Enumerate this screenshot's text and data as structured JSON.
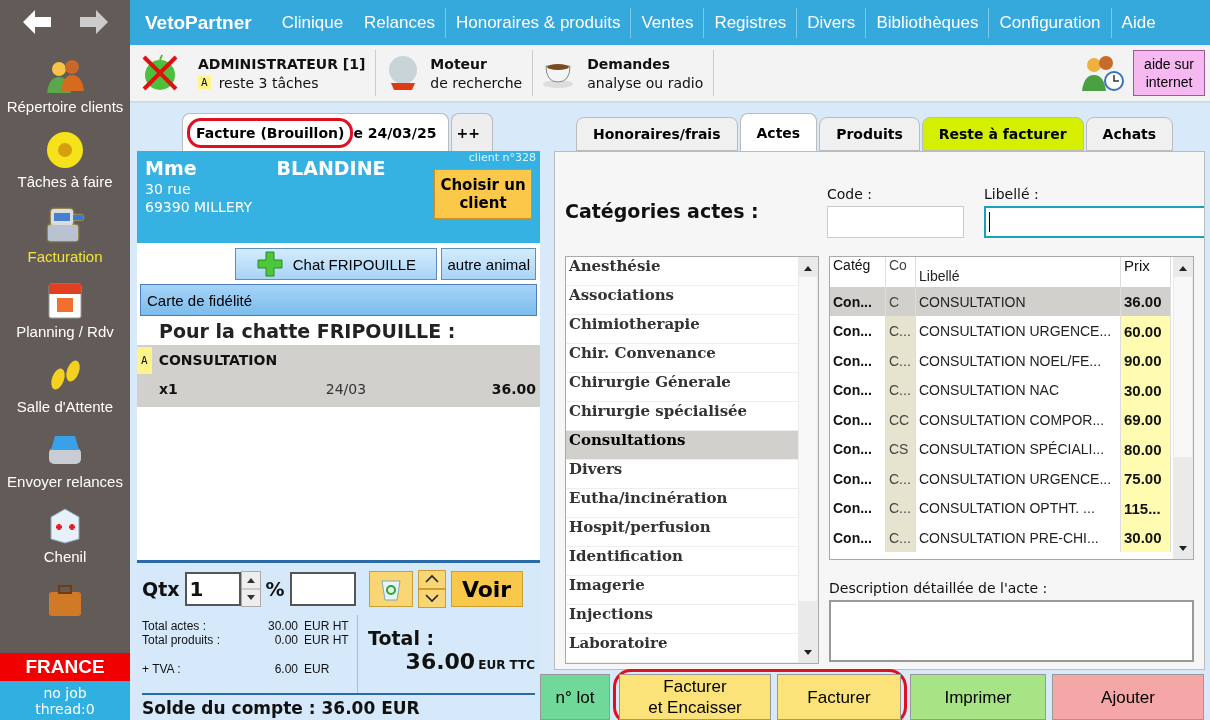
{
  "menu": {
    "brand": "VetoPartner",
    "items": [
      {
        "label": "Clinique",
        "divider": false
      },
      {
        "label": "Relances",
        "divider": true
      },
      {
        "label": "Honoraires & produits",
        "divider": true
      },
      {
        "label": "Ventes",
        "divider": true
      },
      {
        "label": "Registres",
        "divider": true
      },
      {
        "label": "Divers",
        "divider": true
      },
      {
        "label": "Bibliothèques",
        "divider": true
      },
      {
        "label": "Configuration",
        "divider": true
      },
      {
        "label": "Aide",
        "divider": false
      }
    ]
  },
  "sidebar": {
    "items": [
      {
        "label": "Répertoire clients",
        "selected": false
      },
      {
        "label": "Tâches à faire",
        "selected": false
      },
      {
        "label": "Facturation",
        "selected": true
      },
      {
        "label": "Planning / Rdv",
        "selected": false
      },
      {
        "label": "Salle d'Attente",
        "selected": false
      },
      {
        "label": "Envoyer relances",
        "selected": false
      },
      {
        "label": "Chenil",
        "selected": false
      },
      {
        "selected": false
      }
    ]
  },
  "status": {
    "country": "FRANCE",
    "job": "no job",
    "thread": "thread:0"
  },
  "header": {
    "user": "ADMINISTRATEUR [1]",
    "task_badge": "A",
    "tasks": "reste 3 tâches",
    "search_title": "Moteur",
    "search_sub": "de recherche",
    "requests_title": "Demandes",
    "requests_sub": "analyse ou radio",
    "help": "aide sur internet"
  },
  "invoice_tabs": [
    {
      "label": "Facture (Brouillon)",
      "tail": "e 24/03/25",
      "selected": true,
      "highlighted": true
    },
    {
      "label": "++",
      "selected": false,
      "highlighted": false
    }
  ],
  "client": {
    "number": "client n°328",
    "title": "Mme",
    "name": "BLANDINE",
    "address": [
      "30 rue",
      "69390 MILLERY"
    ],
    "choose_button": "Choisir un client",
    "animal_button": "Chat FRIPOUILLE",
    "other_animal_button": "autre animal",
    "loyalty_card": "Carte de fidélité"
  },
  "invoice": {
    "heading": "Pour la chatte FRIPOUILLE :",
    "lines": [
      {
        "badge": "A",
        "name": "CONSULTATION",
        "qty": "x1",
        "date": "24/03",
        "amount": "36.00",
        "selected": true
      }
    ]
  },
  "entry": {
    "qty_label": "Qtx",
    "qty": "1",
    "pct_label": "%",
    "view_button": "Voir"
  },
  "totals": {
    "rows": [
      {
        "kind": "line",
        "label": "Total actes :",
        "amount": "30.00",
        "unit": "EUR HT"
      },
      {
        "kind": "line",
        "label": "Total produits :",
        "amount": "0.00",
        "unit": "EUR HT"
      },
      {
        "kind": "tax",
        "label": "+ TVA :",
        "amount": "6.00",
        "unit": "EUR"
      }
    ],
    "total_label": "Total :",
    "total": "36.00",
    "total_unit": "EUR TTC",
    "balance": "Solde du compte : 36.00 EUR"
  },
  "section_tabs": [
    {
      "label": "Honoraires/frais",
      "selected": false,
      "color": "#f0f0f0"
    },
    {
      "label": "Actes",
      "selected": true,
      "color": "#ffffff"
    },
    {
      "label": "Produits",
      "selected": false,
      "color": "#f0f0f0"
    },
    {
      "label": "Reste à facturer",
      "selected": false,
      "color": "#d4f000"
    },
    {
      "label": "Achats",
      "selected": false,
      "color": "#f0f0f0"
    }
  ],
  "acts": {
    "heading": "Catégories actes :",
    "code_label": "Code :",
    "label_label": "Libellé :",
    "categories": [
      {
        "label": "Anesthésie",
        "selected": false
      },
      {
        "label": "Associations",
        "selected": false
      },
      {
        "label": "Chimiotherapie",
        "selected": false
      },
      {
        "label": "Chir. Convenance",
        "selected": false
      },
      {
        "label": "Chirurgie Génerale",
        "selected": false
      },
      {
        "label": "Chirurgie spécialisée",
        "selected": false
      },
      {
        "label": "Consultations",
        "selected": true
      },
      {
        "label": "Divers",
        "selected": false
      },
      {
        "label": "Eutha/incinération",
        "selected": false
      },
      {
        "label": "Hospit/perfusion",
        "selected": false
      },
      {
        "label": "Identification",
        "selected": false
      },
      {
        "label": "Imagerie",
        "selected": false
      },
      {
        "label": "Injections",
        "selected": false
      },
      {
        "label": "Laboratoire",
        "selected": false
      }
    ],
    "table": {
      "columns": [
        "Catég",
        "Co",
        "Libellé",
        "Prix"
      ],
      "rows": [
        {
          "cells": [
            "Con...",
            "C",
            "CONSULTATION",
            "36.00"
          ],
          "selected": true
        },
        {
          "cells": [
            "Con...",
            "C...",
            "CONSULTATION URGENCE...",
            "60.00"
          ],
          "selected": false
        },
        {
          "cells": [
            "Con...",
            "C...",
            "CONSULTATION NOEL/FE...",
            "90.00"
          ],
          "selected": false
        },
        {
          "cells": [
            "Con...",
            "C...",
            "CONSULTATION NAC",
            "30.00"
          ],
          "selected": false
        },
        {
          "cells": [
            "Con...",
            "CC",
            "CONSULTATION COMPOR...",
            "69.00"
          ],
          "selected": false
        },
        {
          "cells": [
            "Con...",
            "CS",
            "CONSULTATION SPÉCIALI...",
            "80.00"
          ],
          "selected": false
        },
        {
          "cells": [
            "Con...",
            "C...",
            "CONSULTATION URGENCE...",
            "75.00"
          ],
          "selected": false
        },
        {
          "cells": [
            "Con...",
            "C...",
            "CONSULTATION OPTHT. ...",
            "115..."
          ],
          "selected": false
        },
        {
          "cells": [
            "Con...",
            "C...",
            "CONSULTATION PRE-CHI...",
            "30.00"
          ],
          "selected": false
        }
      ]
    },
    "description_label": "Description détaillée de l'acte :"
  },
  "actions": [
    {
      "label": "n° lot",
      "color": "#70d898",
      "highlighted": false
    },
    {
      "label": "Facturer\net Encaisser",
      "color": "#fbe37a",
      "highlighted": true
    },
    {
      "label": "Facturer",
      "color": "#fbe37a",
      "highlighted": true
    },
    {
      "label": "Imprimer",
      "color": "#a6e486",
      "highlighted": false
    },
    {
      "label": "Ajouter",
      "color": "#f5a6a6",
      "highlighted": false
    }
  ]
}
